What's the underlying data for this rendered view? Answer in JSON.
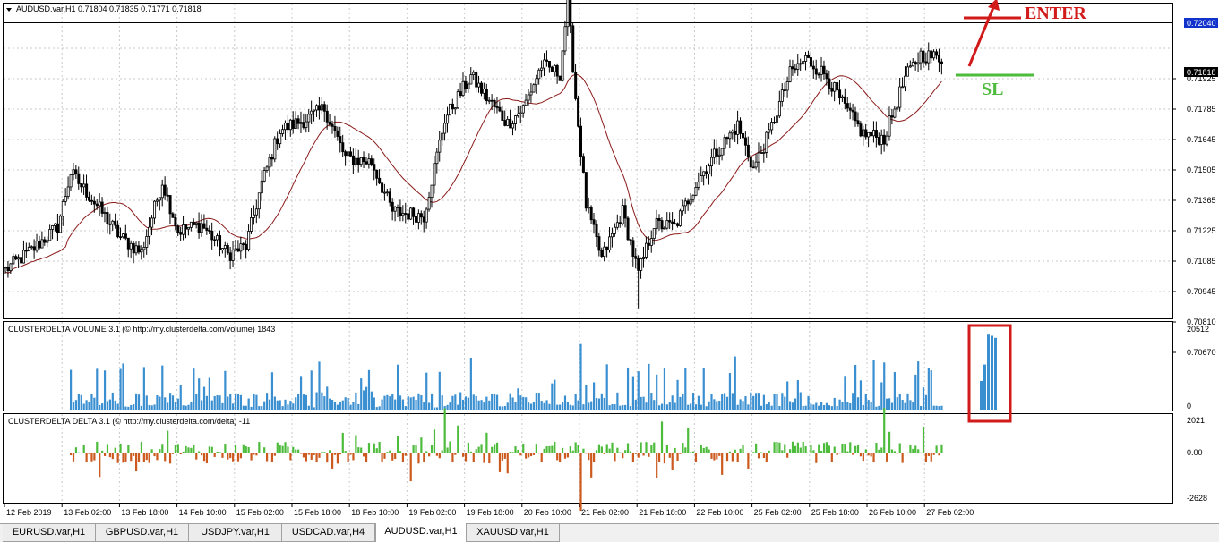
{
  "colors": {
    "bull": "#2f2f2f",
    "bear": "#000000",
    "ma": "#8b1a1a",
    "volume": "#3a8fd1",
    "delta_pos": "#4dbb3b",
    "delta_neg": "#cc5a1e",
    "enter": "#d11a1a",
    "sl": "#4dbb3b",
    "box": "#d11a1a",
    "grid": "#c8c8c8"
  },
  "price_panel": {
    "title": "AUDUSD.var,H1  0.71804 0.71835 0.71771 0.71818",
    "menu_icon": "triangle-down-icon",
    "axis_labels": [
      "0.72040",
      "0.71925",
      "0.71785",
      "0.71645",
      "0.71505",
      "0.71365",
      "0.71225",
      "0.71085",
      "0.70945",
      "0.70810",
      "0.70670"
    ],
    "current_price": "0.71818",
    "top_price": "0.72040",
    "enter_label": "ENTER",
    "sl_label": "SL"
  },
  "volume_panel": {
    "title": "CLUSTERDELTA VOLUME 3.1 (© http://my.clusterdelta.com/volume) 1843",
    "max_label": "20512",
    "min_label": "0"
  },
  "delta_panel": {
    "title": "CLUSTERDELTA DELTA 3.1 (© http://my.clusterdelta.com/delta) -11",
    "max_label": "2021",
    "zero_label": "0.00",
    "min_label": "-2628"
  },
  "time_axis": [
    "12 Feb 2019",
    "13 Feb 02:00",
    "13 Feb 18:00",
    "14 Feb 10:00",
    "15 Feb 02:00",
    "15 Feb 18:00",
    "18 Feb 10:00",
    "19 Feb 02:00",
    "19 Feb 18:00",
    "20 Feb 10:00",
    "21 Feb 02:00",
    "21 Feb 18:00",
    "22 Feb 10:00",
    "25 Feb 02:00",
    "25 Feb 18:00",
    "26 Feb 10:00",
    "27 Feb 02:00"
  ],
  "tabs": [
    {
      "label": "EURUSD.var,H1",
      "active": false
    },
    {
      "label": "GBPUSD.var,H1",
      "active": false
    },
    {
      "label": "USDJPY.var,H1",
      "active": false
    },
    {
      "label": "USDCAD.var,H4",
      "active": false
    },
    {
      "label": "AUDUSD.var,H1",
      "active": true
    },
    {
      "label": "XAUUSD.var,H1",
      "active": false
    }
  ],
  "chart_data": {
    "type": "candlestick",
    "ylim": [
      0.7064,
      0.7207
    ],
    "close_keypoints": [
      [
        0,
        0.7085
      ],
      [
        10,
        0.7094
      ],
      [
        20,
        0.7105
      ],
      [
        25,
        0.713
      ],
      [
        33,
        0.7118
      ],
      [
        44,
        0.71
      ],
      [
        52,
        0.7093
      ],
      [
        60,
        0.7126
      ],
      [
        66,
        0.7103
      ],
      [
        75,
        0.7106
      ],
      [
        85,
        0.7092
      ],
      [
        92,
        0.7096
      ],
      [
        98,
        0.7125
      ],
      [
        105,
        0.715
      ],
      [
        115,
        0.7155
      ],
      [
        122,
        0.716
      ],
      [
        130,
        0.7137
      ],
      [
        140,
        0.7135
      ],
      [
        148,
        0.7112
      ],
      [
        160,
        0.711
      ],
      [
        168,
        0.7155
      ],
      [
        178,
        0.7175
      ],
      [
        184,
        0.7165
      ],
      [
        192,
        0.7153
      ],
      [
        198,
        0.716
      ],
      [
        205,
        0.718
      ],
      [
        212,
        0.7176
      ],
      [
        215,
        0.721
      ],
      [
        218,
        0.7165
      ],
      [
        222,
        0.7115
      ],
      [
        228,
        0.709
      ],
      [
        236,
        0.7112
      ],
      [
        242,
        0.7083
      ],
      [
        248,
        0.7106
      ],
      [
        256,
        0.7105
      ],
      [
        264,
        0.7125
      ],
      [
        272,
        0.714
      ],
      [
        280,
        0.7152
      ],
      [
        286,
        0.7132
      ],
      [
        292,
        0.7148
      ],
      [
        300,
        0.7176
      ],
      [
        306,
        0.7183
      ],
      [
        314,
        0.7175
      ],
      [
        320,
        0.7162
      ],
      [
        328,
        0.7148
      ],
      [
        336,
        0.7146
      ],
      [
        344,
        0.7174
      ],
      [
        350,
        0.7185
      ],
      [
        358,
        0.7183
      ]
    ],
    "volume_ylim": [
      0,
      20512
    ],
    "delta_ylim": [
      -2628,
      2021
    ],
    "annotations": [
      "ENTER",
      "SL"
    ]
  }
}
